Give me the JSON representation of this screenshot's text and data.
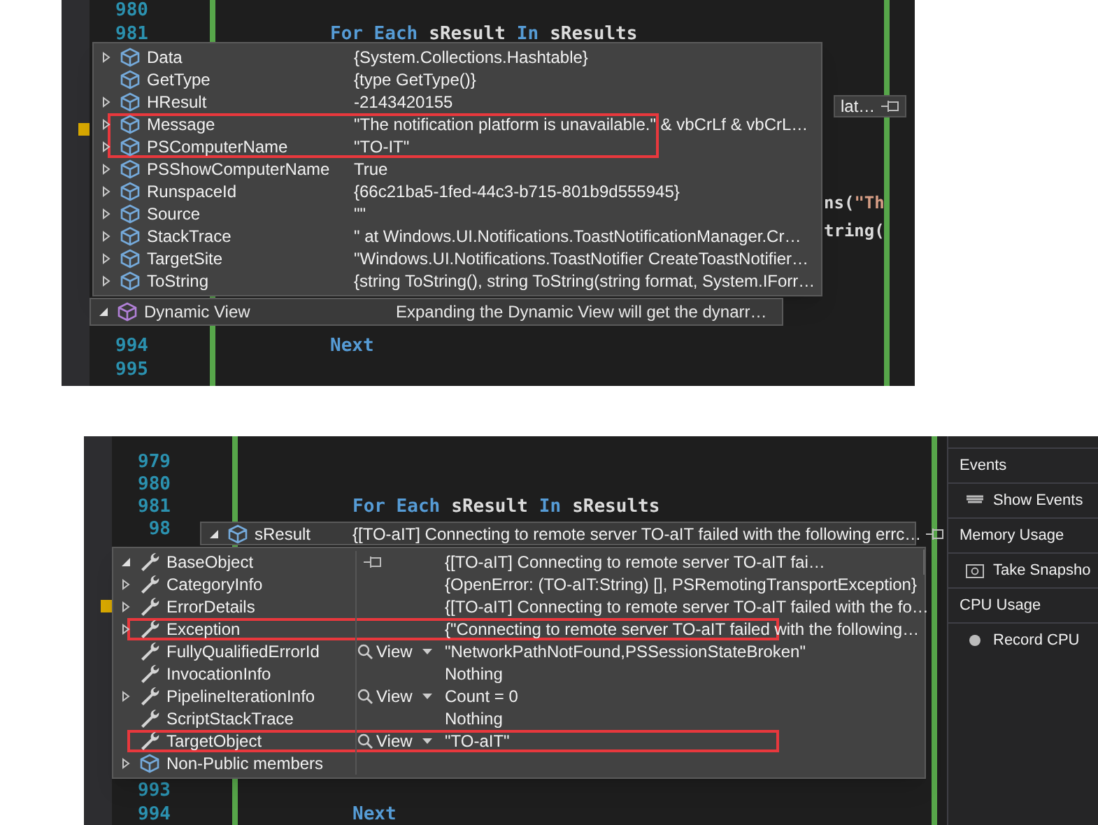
{
  "panels": [
    {
      "lines_top": [
        {
          "number": "980"
        },
        {
          "number": "981",
          "tokens": [
            {
              "text": "For Each",
              "kind": "keyword"
            },
            {
              "text": "sResult",
              "kind": "ident"
            },
            {
              "text": "In",
              "kind": "keyword"
            },
            {
              "text": "sResults",
              "kind": "ident"
            }
          ]
        }
      ],
      "lines_bottom": [
        {
          "number": "994",
          "tokens": [
            {
              "text": "Next",
              "kind": "keyword"
            }
          ]
        },
        {
          "number": "995"
        }
      ],
      "fragments": [
        {
          "text": "ns(",
          "kind": "ident"
        },
        {
          "text": "\"Th",
          "kind": "string"
        },
        {
          "text": "tring(",
          "kind": "ident"
        }
      ],
      "side_tip": {
        "text": "lat…"
      },
      "datatip": {
        "rows": [
          {
            "name": "Data",
            "value": "{System.Collections.Hashtable}",
            "kind": "property",
            "expandable": true,
            "expanded": false,
            "highlighted": false
          },
          {
            "name": "GetType",
            "value": "{type GetType()}",
            "kind": "property",
            "expandable": false,
            "highlighted": false
          },
          {
            "name": "HResult",
            "value": "-2143420155",
            "kind": "property",
            "expandable": true,
            "expanded": false,
            "highlighted": false
          },
          {
            "name": "Message",
            "value": "\"The notification platform is unavailable.\" & vbCrLf & vbCrL…",
            "kind": "property",
            "expandable": true,
            "expanded": false,
            "highlighted": true
          },
          {
            "name": "PSComputerName",
            "value": "\"TO-IT\"",
            "kind": "property",
            "expandable": true,
            "expanded": false,
            "highlighted": true
          },
          {
            "name": "PSShowComputerName",
            "value": "True",
            "kind": "property",
            "expandable": true,
            "expanded": false,
            "highlighted": false
          },
          {
            "name": "RunspaceId",
            "value": "{66c21ba5-1fed-44c3-b715-801b9d555945}",
            "kind": "property",
            "expandable": true,
            "expanded": false,
            "highlighted": false
          },
          {
            "name": "Source",
            "value": "\"\"",
            "kind": "property",
            "expandable": true,
            "expanded": false,
            "highlighted": false
          },
          {
            "name": "StackTrace",
            "value": "\"   at Windows.UI.Notifications.ToastNotificationManager.Cr…",
            "kind": "property",
            "expandable": true,
            "expanded": false,
            "highlighted": false
          },
          {
            "name": "TargetSite",
            "value": "\"Windows.UI.Notifications.ToastNotifier CreateToastNotifier…",
            "kind": "property",
            "expandable": true,
            "expanded": false,
            "highlighted": false
          },
          {
            "name": "ToString",
            "value": "{string ToString(), string ToString(string format, System.IForr…",
            "kind": "property",
            "expandable": true,
            "expanded": false,
            "highlighted": false
          }
        ],
        "footer": {
          "name": "Dynamic View",
          "value": "Expanding the Dynamic View will get the dynarr…",
          "expanded": true
        }
      }
    },
    {
      "lines_top": [
        {
          "number": "979"
        },
        {
          "number": "980"
        },
        {
          "number": "981",
          "tokens": [
            {
              "text": "For Each",
              "kind": "keyword"
            },
            {
              "text": "sResult",
              "kind": "ident"
            },
            {
              "text": "In",
              "kind": "keyword"
            },
            {
              "text": "sResults",
              "kind": "ident"
            }
          ]
        },
        {
          "number": "98"
        }
      ],
      "lines_bottom": [
        {
          "number": "993"
        },
        {
          "number": "994",
          "tokens": [
            {
              "text": "Next",
              "kind": "keyword"
            }
          ]
        }
      ],
      "parent_tip": {
        "name": "sResult",
        "value": "{[TO-aIT] Connecting to remote server TO-aIT failed with the following errc…",
        "expanded": true
      },
      "datatip": {
        "rows": [
          {
            "name": "BaseObject",
            "value": "{[TO-aIT] Connecting to remote server TO-aIT fai…",
            "kind": "member",
            "expandable": true,
            "expanded": true,
            "highlighted": false,
            "pinned": true
          },
          {
            "name": "CategoryInfo",
            "value": "{OpenError: (TO-aIT:String) [], PSRemotingTransportException}",
            "kind": "member",
            "expandable": true,
            "expanded": false,
            "highlighted": false
          },
          {
            "name": "ErrorDetails",
            "value": "{[TO-aIT] Connecting to remote server TO-aIT failed with the fo…",
            "kind": "member",
            "expandable": true,
            "expanded": false,
            "highlighted": false
          },
          {
            "name": "Exception",
            "value": "{\"Connecting to remote server TO-aIT failed with the following…",
            "kind": "member",
            "expandable": true,
            "expanded": false,
            "highlighted": true
          },
          {
            "name": "FullyQualifiedErrorId",
            "value": "\"NetworkPathNotFound,PSSessionStateBroken\"",
            "kind": "member",
            "expandable": false,
            "highlighted": false,
            "view": "View"
          },
          {
            "name": "InvocationInfo",
            "value": "Nothing",
            "kind": "member",
            "expandable": false,
            "highlighted": false
          },
          {
            "name": "PipelineIterationInfo",
            "value": "Count = 0",
            "kind": "member",
            "expandable": true,
            "expanded": false,
            "highlighted": false,
            "view": "View"
          },
          {
            "name": "ScriptStackTrace",
            "value": "Nothing",
            "kind": "member",
            "expandable": false,
            "highlighted": false
          },
          {
            "name": "TargetObject",
            "value": "\"TO-aIT\"",
            "kind": "member",
            "expandable": false,
            "highlighted": true,
            "view": "View"
          },
          {
            "name": "Non-Public members",
            "kind": "property",
            "expandable": true,
            "expanded": false,
            "highlighted": false
          }
        ]
      },
      "sidebar": [
        {
          "text": "Events",
          "kind": "header"
        },
        {
          "text": "Show Events",
          "kind": "action"
        },
        {
          "text": "Memory Usage",
          "kind": "header"
        },
        {
          "text": "Take Snapsho",
          "kind": "action"
        },
        {
          "text": "CPU Usage",
          "kind": "header"
        },
        {
          "text": "Record CPU",
          "kind": "action"
        }
      ]
    }
  ]
}
